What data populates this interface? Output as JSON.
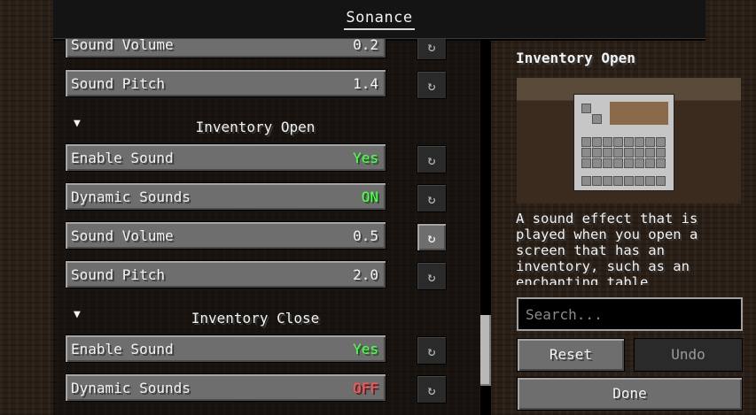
{
  "title": "Sonance",
  "reset_glyph": "↻",
  "settings": [
    {
      "type": "row",
      "label": "Sound Volume",
      "value": "0.2",
      "value_color": "white"
    },
    {
      "type": "row",
      "label": "Sound Pitch",
      "value": "1.4",
      "value_color": "white"
    },
    {
      "type": "section",
      "label": "Inventory Open",
      "arrow": "▼"
    },
    {
      "type": "row",
      "label": "Enable Sound",
      "value": "Yes",
      "value_color": "green"
    },
    {
      "type": "row",
      "label": "Dynamic Sounds",
      "value": "ON",
      "value_color": "green"
    },
    {
      "type": "row",
      "label": "Sound Volume",
      "value": "0.5",
      "value_color": "white",
      "reset_active": true
    },
    {
      "type": "row",
      "label": "Sound Pitch",
      "value": "2.0",
      "value_color": "white"
    },
    {
      "type": "section",
      "label": "Inventory Close",
      "arrow": "▼"
    },
    {
      "type": "row",
      "label": "Enable Sound",
      "value": "Yes",
      "value_color": "green"
    },
    {
      "type": "row",
      "label": "Dynamic Sounds",
      "value": "OFF",
      "value_color": "red"
    }
  ],
  "sidebar": {
    "heading": "Inventory Open",
    "description": "A sound effect that is played when you open a screen that has an inventory, such as an enchanting table",
    "search_placeholder": "Search...",
    "reset_label": "Reset",
    "undo_label": "Undo",
    "done_label": "Done"
  }
}
